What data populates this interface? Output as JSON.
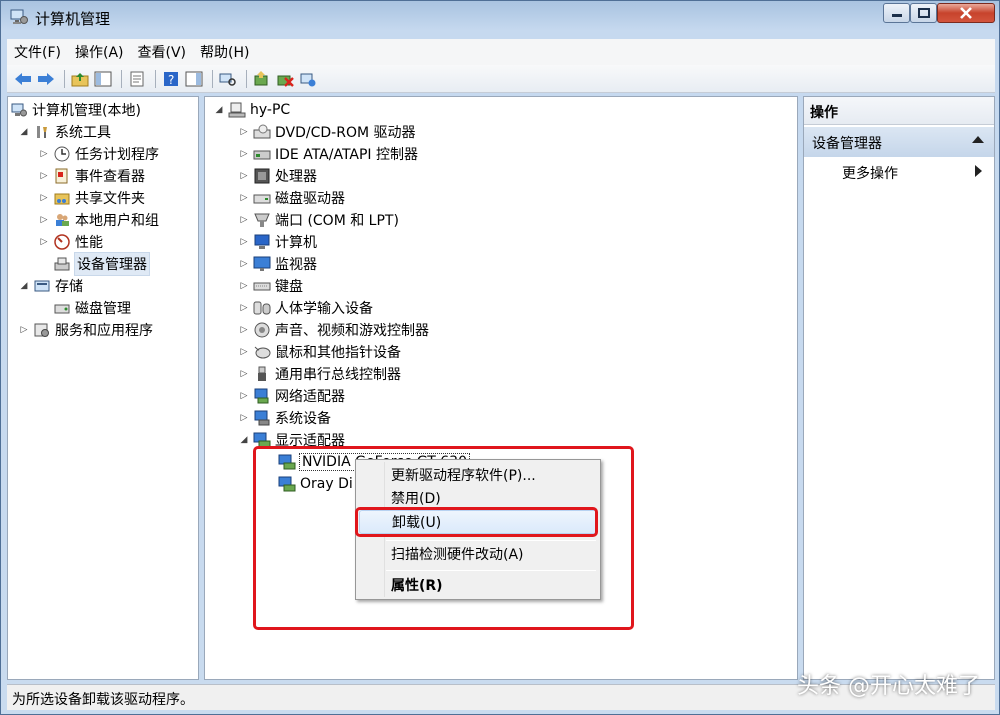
{
  "window": {
    "title": "计算机管理"
  },
  "menubar": [
    "文件(F)",
    "操作(A)",
    "查看(V)",
    "帮助(H)"
  ],
  "left_tree": [
    {
      "label": "计算机管理(本地)",
      "icon": "computer-management-icon",
      "expander": ""
    },
    {
      "label": "系统工具",
      "icon": "tools-icon",
      "expander": "◢"
    },
    {
      "label": "任务计划程序",
      "icon": "clock-icon",
      "expander": "▷"
    },
    {
      "label": "事件查看器",
      "icon": "event-viewer-icon",
      "expander": "▷"
    },
    {
      "label": "共享文件夹",
      "icon": "shared-folder-icon",
      "expander": "▷"
    },
    {
      "label": "本地用户和组",
      "icon": "users-icon",
      "expander": "▷"
    },
    {
      "label": "性能",
      "icon": "performance-icon",
      "expander": "▷"
    },
    {
      "label": "设备管理器",
      "icon": "device-manager-icon",
      "expander": ""
    },
    {
      "label": "存储",
      "icon": "storage-icon",
      "expander": "◢"
    },
    {
      "label": "磁盘管理",
      "icon": "disk-management-icon",
      "expander": ""
    },
    {
      "label": "服务和应用程序",
      "icon": "services-icon",
      "expander": "▷"
    }
  ],
  "device_tree": {
    "root": "hy-PC",
    "categories": [
      "DVD/CD-ROM 驱动器",
      "IDE ATA/ATAPI 控制器",
      "处理器",
      "磁盘驱动器",
      "端口 (COM 和 LPT)",
      "计算机",
      "监视器",
      "键盘",
      "人体学输入设备",
      "声音、视频和游戏控制器",
      "鼠标和其他指针设备",
      "通用串行总线控制器",
      "网络适配器",
      "系统设备",
      "显示适配器"
    ],
    "display_children": [
      "NVIDIA GeForce GT 630",
      "Oray Di"
    ]
  },
  "actions": {
    "header": "操作",
    "group": "设备管理器",
    "more": "更多操作"
  },
  "context_menu": {
    "update": "更新驱动程序软件(P)...",
    "disable": "禁用(D)",
    "uninstall": "卸载(U)",
    "scan": "扫描检测硬件改动(A)",
    "properties": "属性(R)"
  },
  "statusbar": {
    "text": "为所选设备卸载该驱动程序。"
  },
  "watermark": "头条 @开心太难了",
  "colors": {
    "highlight_box": "#e0161c",
    "selection": "#dfe9f5"
  }
}
